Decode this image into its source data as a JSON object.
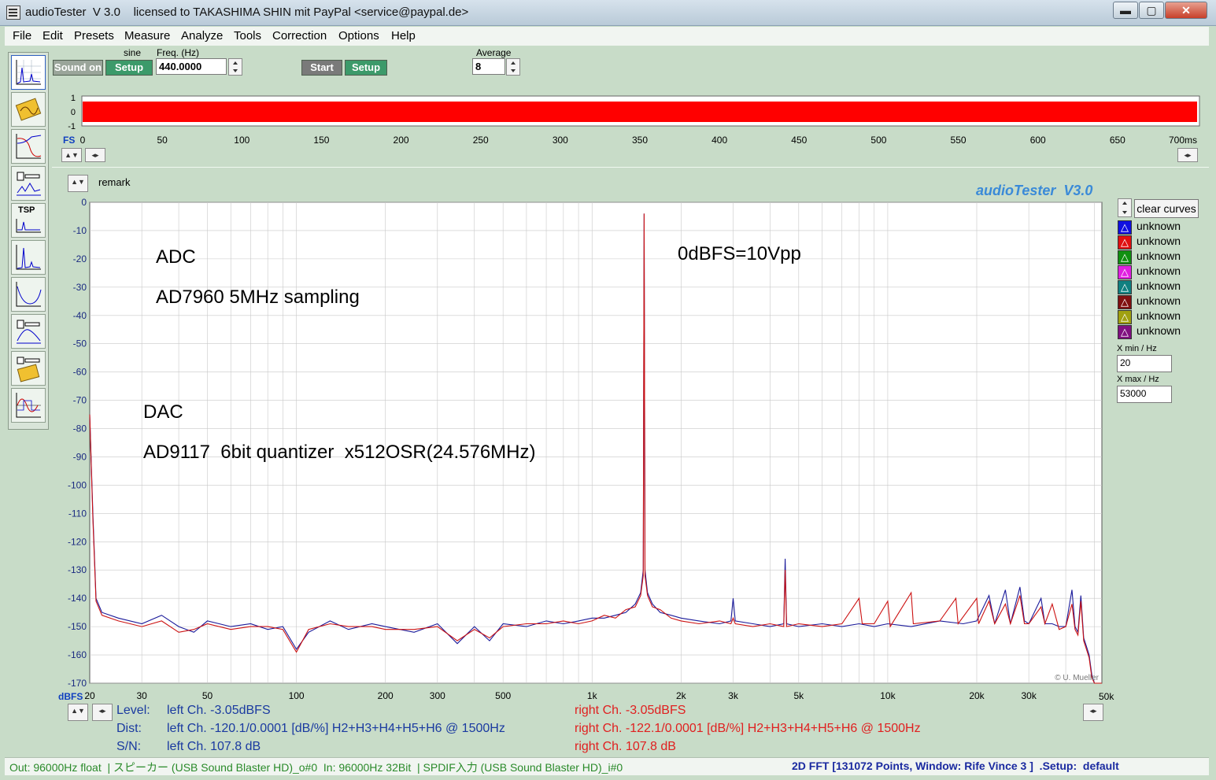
{
  "window": {
    "title": "audioTester  V 3.0    licensed to TAKASHIMA SHIN mit PayPal <service@paypal.de>",
    "btn_min": "▬",
    "btn_max": "▢",
    "btn_close": "✕"
  },
  "menu": [
    "File",
    "Edit",
    "Presets",
    "Measure",
    "Analyze",
    "Tools",
    "Correction",
    "Options",
    "Help"
  ],
  "toolbar": {
    "sound_on": "Sound on",
    "setup": "Setup",
    "signal_type": "sine",
    "freq_label": "Freq. (Hz)",
    "freq_value": "440.0000",
    "start": "Start",
    "setup2": "Setup",
    "average_label": "Average",
    "average_value": "8",
    "tool_icons": [
      "fft-icon",
      "sweep-icon",
      "bode-icon",
      "level-icon",
      "tsp-icon",
      "spectrum-icon",
      "curve-icon",
      "filter-icon",
      "speaker-icon",
      "wave-icon"
    ],
    "tsp_label": "TSP"
  },
  "scope": {
    "fs_label": "FS",
    "y_ticks": [
      "1",
      "0",
      "-1"
    ],
    "x_ticks": [
      "0",
      "50",
      "100",
      "150",
      "200",
      "250",
      "300",
      "350",
      "400",
      "450",
      "500",
      "550",
      "600",
      "650",
      "700ms"
    ],
    "signal_color": "#ff0000"
  },
  "plot": {
    "remark": "remark",
    "brand": "audioTester  V3.0",
    "watermark": "© U. Mueller",
    "clear_curves": "clear curves",
    "y_unit": "dBFS",
    "x_unit": "50kHz",
    "x_min_label": "X min / Hz",
    "x_min_value": "20",
    "x_max_label": "X max / Hz",
    "x_max_value": "53000",
    "annotations": {
      "adc": "ADC",
      "adc_chip": "AD7960 5MHz sampling",
      "ref": "0dBFS=10Vpp",
      "dac": "DAC",
      "dac_chip": "AD9117  6bit quantizer  x512OSR(24.576MHz)"
    },
    "legend": [
      {
        "label": "unknown",
        "color": "#1010e0"
      },
      {
        "label": "unknown",
        "color": "#e01010"
      },
      {
        "label": "unknown",
        "color": "#109010"
      },
      {
        "label": "unknown",
        "color": "#e020e0"
      },
      {
        "label": "unknown",
        "color": "#108080"
      },
      {
        "label": "unknown",
        "color": "#801010"
      },
      {
        "label": "unknown",
        "color": "#a0a010"
      },
      {
        "label": "unknown",
        "color": "#801080"
      }
    ]
  },
  "chart_data": {
    "type": "line",
    "title": "",
    "xlabel": "",
    "ylabel": "dBFS",
    "x_scale": "log",
    "xlim": [
      20,
      53000
    ],
    "ylim": [
      -170,
      0
    ],
    "x_ticks": [
      {
        "v": 20,
        "t": "20"
      },
      {
        "v": 30,
        "t": "30"
      },
      {
        "v": 50,
        "t": "50"
      },
      {
        "v": 100,
        "t": "100"
      },
      {
        "v": 200,
        "t": "200"
      },
      {
        "v": 300,
        "t": "300"
      },
      {
        "v": 500,
        "t": "500"
      },
      {
        "v": 1000,
        "t": "1k"
      },
      {
        "v": 2000,
        "t": "2k"
      },
      {
        "v": 3000,
        "t": "3k"
      },
      {
        "v": 5000,
        "t": "5k"
      },
      {
        "v": 10000,
        "t": "10k"
      },
      {
        "v": 20000,
        "t": "20k"
      },
      {
        "v": 30000,
        "t": "30k"
      }
    ],
    "y_ticks": [
      0,
      -10,
      -20,
      -30,
      -40,
      -50,
      -60,
      -70,
      -80,
      -90,
      -100,
      -110,
      -120,
      -130,
      -140,
      -150,
      -160,
      -170
    ],
    "grid": true,
    "series": [
      {
        "color": "#1a1a9a",
        "points": [
          [
            20,
            -75
          ],
          [
            20.5,
            -110
          ],
          [
            21,
            -140
          ],
          [
            22,
            -145
          ],
          [
            25,
            -147
          ],
          [
            30,
            -149
          ],
          [
            35,
            -146
          ],
          [
            40,
            -150
          ],
          [
            45,
            -152
          ],
          [
            50,
            -148
          ],
          [
            60,
            -150
          ],
          [
            70,
            -149
          ],
          [
            80,
            -151
          ],
          [
            90,
            -150
          ],
          [
            100,
            -158
          ],
          [
            110,
            -152
          ],
          [
            130,
            -148
          ],
          [
            150,
            -151
          ],
          [
            180,
            -149
          ],
          [
            200,
            -150
          ],
          [
            250,
            -152
          ],
          [
            300,
            -149
          ],
          [
            350,
            -156
          ],
          [
            400,
            -150
          ],
          [
            450,
            -155
          ],
          [
            500,
            -149
          ],
          [
            600,
            -150
          ],
          [
            700,
            -148
          ],
          [
            800,
            -149
          ],
          [
            900,
            -148
          ],
          [
            1000,
            -147
          ],
          [
            1100,
            -147
          ],
          [
            1200,
            -146
          ],
          [
            1300,
            -145
          ],
          [
            1400,
            -142
          ],
          [
            1460,
            -138
          ],
          [
            1490,
            -130
          ],
          [
            1500,
            -4
          ],
          [
            1510,
            -130
          ],
          [
            1540,
            -138
          ],
          [
            1600,
            -142
          ],
          [
            1700,
            -145
          ],
          [
            1850,
            -146
          ],
          [
            2000,
            -147
          ],
          [
            2300,
            -148
          ],
          [
            2700,
            -149
          ],
          [
            2950,
            -148
          ],
          [
            3000,
            -140
          ],
          [
            3050,
            -148
          ],
          [
            3500,
            -149
          ],
          [
            4000,
            -150
          ],
          [
            4450,
            -149
          ],
          [
            4500,
            -126
          ],
          [
            4550,
            -149
          ],
          [
            5000,
            -150
          ],
          [
            6000,
            -149
          ],
          [
            7000,
            -150
          ],
          [
            8000,
            -149
          ],
          [
            9000,
            -150
          ],
          [
            10000,
            -149
          ],
          [
            12000,
            -150
          ],
          [
            15000,
            -148
          ],
          [
            18000,
            -149
          ],
          [
            20000,
            -148
          ],
          [
            22000,
            -139
          ],
          [
            23000,
            -149
          ],
          [
            25000,
            -137
          ],
          [
            26000,
            -149
          ],
          [
            28000,
            -136
          ],
          [
            29000,
            -148
          ],
          [
            30000,
            -149
          ],
          [
            33000,
            -140
          ],
          [
            34000,
            -149
          ],
          [
            36000,
            -149
          ],
          [
            38000,
            -150
          ],
          [
            40000,
            -150
          ],
          [
            42000,
            -137
          ],
          [
            43000,
            -150
          ],
          [
            44000,
            -152
          ],
          [
            45000,
            -139
          ],
          [
            46000,
            -154
          ],
          [
            47000,
            -157
          ],
          [
            48000,
            -160
          ],
          [
            49000,
            -167
          ],
          [
            50000,
            -170
          ],
          [
            53000,
            -170
          ]
        ]
      },
      {
        "color": "#cc1111",
        "points": [
          [
            20,
            -75
          ],
          [
            20.5,
            -112
          ],
          [
            21,
            -141
          ],
          [
            22,
            -146
          ],
          [
            25,
            -148
          ],
          [
            30,
            -150
          ],
          [
            35,
            -148
          ],
          [
            40,
            -152
          ],
          [
            45,
            -151
          ],
          [
            50,
            -149
          ],
          [
            60,
            -151
          ],
          [
            70,
            -150
          ],
          [
            80,
            -150
          ],
          [
            90,
            -151
          ],
          [
            100,
            -159
          ],
          [
            110,
            -151
          ],
          [
            130,
            -149
          ],
          [
            150,
            -150
          ],
          [
            180,
            -150
          ],
          [
            200,
            -151
          ],
          [
            250,
            -151
          ],
          [
            300,
            -150
          ],
          [
            350,
            -155
          ],
          [
            400,
            -151
          ],
          [
            450,
            -154
          ],
          [
            500,
            -150
          ],
          [
            600,
            -149
          ],
          [
            700,
            -149
          ],
          [
            800,
            -148
          ],
          [
            900,
            -149
          ],
          [
            1000,
            -148
          ],
          [
            1100,
            -146
          ],
          [
            1200,
            -147
          ],
          [
            1300,
            -144
          ],
          [
            1400,
            -143
          ],
          [
            1460,
            -139
          ],
          [
            1490,
            -132
          ],
          [
            1500,
            -4
          ],
          [
            1510,
            -132
          ],
          [
            1540,
            -139
          ],
          [
            1600,
            -143
          ],
          [
            1700,
            -144
          ],
          [
            1850,
            -147
          ],
          [
            2000,
            -148
          ],
          [
            2300,
            -149
          ],
          [
            2700,
            -148
          ],
          [
            2950,
            -149
          ],
          [
            3000,
            -147
          ],
          [
            3050,
            -149
          ],
          [
            3500,
            -150
          ],
          [
            4000,
            -149
          ],
          [
            4450,
            -150
          ],
          [
            4500,
            -130
          ],
          [
            4550,
            -150
          ],
          [
            5000,
            -149
          ],
          [
            6000,
            -150
          ],
          [
            7000,
            -149
          ],
          [
            8000,
            -140
          ],
          [
            8200,
            -149
          ],
          [
            9000,
            -149
          ],
          [
            10000,
            -141
          ],
          [
            10200,
            -150
          ],
          [
            12000,
            -138
          ],
          [
            12200,
            -149
          ],
          [
            15000,
            -148
          ],
          [
            17000,
            -140
          ],
          [
            17300,
            -149
          ],
          [
            20000,
            -140
          ],
          [
            20300,
            -149
          ],
          [
            22000,
            -141
          ],
          [
            23000,
            -149
          ],
          [
            25000,
            -142
          ],
          [
            26000,
            -149
          ],
          [
            28000,
            -139
          ],
          [
            29000,
            -149
          ],
          [
            30000,
            -149
          ],
          [
            33000,
            -143
          ],
          [
            34000,
            -149
          ],
          [
            36000,
            -142
          ],
          [
            38000,
            -151
          ],
          [
            40000,
            -150
          ],
          [
            42000,
            -142
          ],
          [
            43000,
            -151
          ],
          [
            44000,
            -153
          ],
          [
            45000,
            -141
          ],
          [
            46000,
            -155
          ],
          [
            47000,
            -158
          ],
          [
            48000,
            -161
          ],
          [
            49000,
            -168
          ],
          [
            50000,
            -170
          ],
          [
            53000,
            -170
          ]
        ]
      }
    ]
  },
  "readout": {
    "level_label": "Level:",
    "dist_label": "Dist:",
    "sn_label": "S/N:",
    "left_level": "left Ch. -3.05dBFS",
    "left_dist": "left Ch. -120.1/0.0001 [dB/%] H2+H3+H4+H5+H6 @ 1500Hz",
    "left_sn": "left Ch. 107.8 dB",
    "right_level": "right Ch. -3.05dBFS",
    "right_dist": "right Ch. -122.1/0.0001 [dB/%] H2+H3+H4+H5+H6 @ 1500Hz",
    "right_sn": "right Ch. 107.8 dB"
  },
  "status": {
    "left": "Out: 96000Hz float  | スピーカー (USB Sound Blaster HD)_o#0  In: 96000Hz 32Bit  | SPDIF入力 (USB Sound Blaster HD)_i#0",
    "right": "2D FFT [131072 Points, Window: Rife Vince 3 ]  .Setup:  default"
  }
}
